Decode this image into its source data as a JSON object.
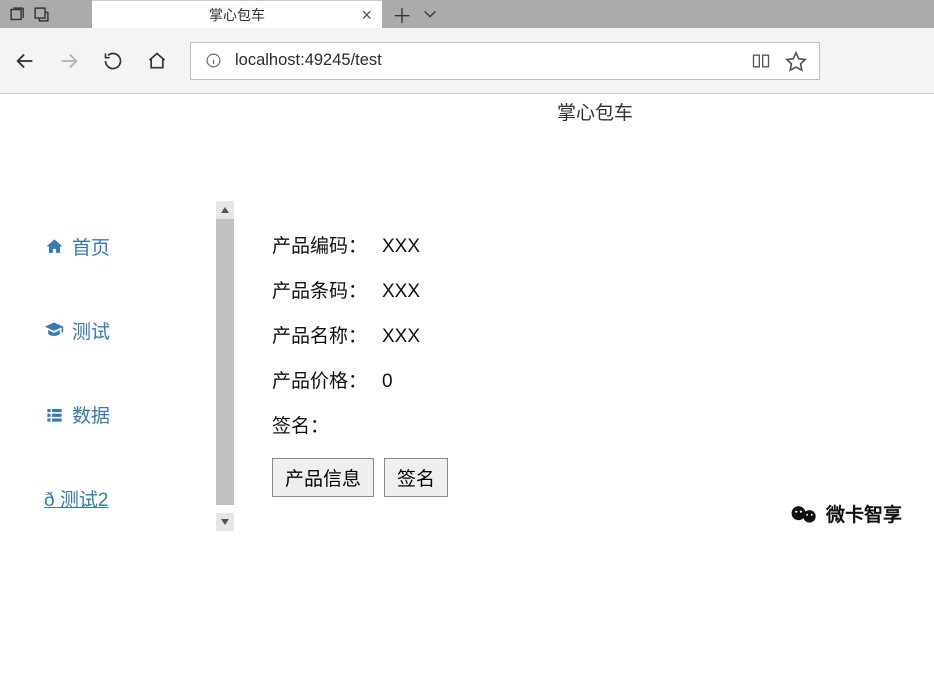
{
  "browser": {
    "tab_title": "掌心包车",
    "address": "localhost:49245/test"
  },
  "page": {
    "title": "掌心包车"
  },
  "sidebar": {
    "items": [
      {
        "label": "首页",
        "icon": "home-icon"
      },
      {
        "label": "测试",
        "icon": "graduation-icon"
      },
      {
        "label": "数据",
        "icon": "list-icon"
      },
      {
        "label": "ð 测试2",
        "icon": "none",
        "active": true
      }
    ]
  },
  "content": {
    "fields": [
      {
        "label": "产品编码：",
        "value": "XXX"
      },
      {
        "label": "产品条码：",
        "value": "XXX"
      },
      {
        "label": "产品名称：",
        "value": "XXX"
      },
      {
        "label": "产品价格：",
        "value": "0"
      },
      {
        "label": "签名：",
        "value": ""
      }
    ],
    "buttons": {
      "info": "产品信息",
      "sign": "签名"
    }
  },
  "watermark": {
    "text": "微卡智享"
  }
}
